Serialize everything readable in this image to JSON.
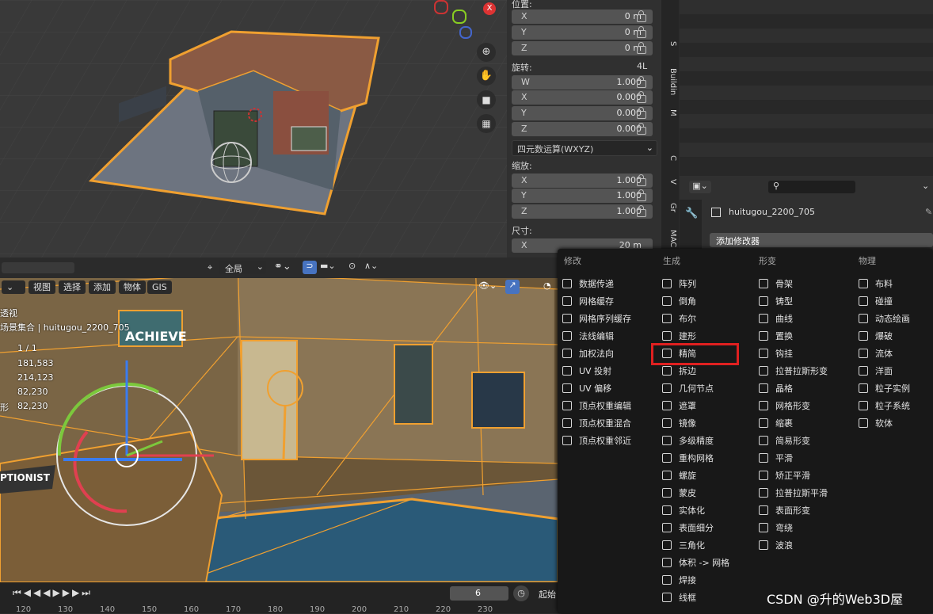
{
  "npanel": {
    "location_label": "位置:",
    "location": [
      {
        "axis": "X",
        "value": "0 m"
      },
      {
        "axis": "Y",
        "value": "0 m"
      },
      {
        "axis": "Z",
        "value": "0 m"
      }
    ],
    "rotation_label": "旋转:",
    "rotation_mode_short": "4L",
    "rotation": [
      {
        "axis": "W",
        "value": "1.000"
      },
      {
        "axis": "X",
        "value": "0.000"
      },
      {
        "axis": "Y",
        "value": "0.000"
      },
      {
        "axis": "Z",
        "value": "0.000"
      }
    ],
    "rotation_mode": "四元数运算(WXYZ)",
    "scale_label": "缩放:",
    "scale": [
      {
        "axis": "X",
        "value": "1.000"
      },
      {
        "axis": "Y",
        "value": "1.000"
      },
      {
        "axis": "Z",
        "value": "1.000"
      }
    ],
    "dimensions_label": "尺寸:",
    "dimensions": [
      {
        "axis": "X",
        "value": "20 m"
      }
    ]
  },
  "side_tabs": [
    "S",
    "Buildin",
    "M",
    "C",
    "V",
    "Gr",
    "MAC"
  ],
  "props": {
    "object_name": "huitugou_2200_705",
    "add_modifier": "添加修改器"
  },
  "viewport": {
    "header_mode": "全局",
    "menu": [
      "视图",
      "选择",
      "添加",
      "物体",
      "GIS"
    ],
    "view_label": "透视",
    "collection": "场景集合 | huitugou_2200_705",
    "stats": [
      {
        "value": "1 / 1"
      },
      {
        "value": "181,583"
      },
      {
        "value": "214,123"
      },
      {
        "value": "82,230"
      },
      {
        "label": "形",
        "value": "82,230"
      }
    ],
    "wall_sign": "ACHIEVE",
    "desk_sign": "PTIONIST"
  },
  "modifier_menu": {
    "columns": [
      {
        "title": "修改",
        "items": [
          "数据传递",
          "网格缓存",
          "网格序列缓存",
          "法线编辑",
          "加权法向",
          "UV 投射",
          "UV 偏移",
          "顶点权重编辑",
          "顶点权重混合",
          "顶点权重邻近"
        ]
      },
      {
        "title": "生成",
        "items": [
          "阵列",
          "倒角",
          "布尔",
          "建形",
          "精简",
          "拆边",
          "几何节点",
          "遮罩",
          "镜像",
          "多级精度",
          "重构网格",
          "螺旋",
          "蒙皮",
          "实体化",
          "表面细分",
          "三角化",
          "体积 -> 网格",
          "焊接",
          "线框"
        ]
      },
      {
        "title": "形变",
        "items": [
          "骨架",
          "铸型",
          "曲线",
          "置换",
          "钩挂",
          "拉普拉斯形变",
          "晶格",
          "网格形变",
          "缩裹",
          "简易形变",
          "平滑",
          "矫正平滑",
          "拉普拉斯平滑",
          "表面形变",
          "弯绕",
          "波浪"
        ]
      },
      {
        "title": "物理",
        "items": [
          "布料",
          "碰撞",
          "动态绘画",
          "爆破",
          "流体",
          "洋面",
          "粒子实例",
          "粒子系统",
          "软体"
        ]
      }
    ],
    "highlighted_item": "精简"
  },
  "timeline": {
    "current_frame": "6",
    "start_label": "起始",
    "ruler": [
      "120",
      "130",
      "140",
      "150",
      "160",
      "170",
      "180",
      "190",
      "200",
      "210",
      "220",
      "230"
    ]
  },
  "watermark": "CSDN @升的Web3D屋",
  "colors": {
    "selection": "#f0a030",
    "highlight": "#e02020",
    "menu_bg": "#181818"
  }
}
